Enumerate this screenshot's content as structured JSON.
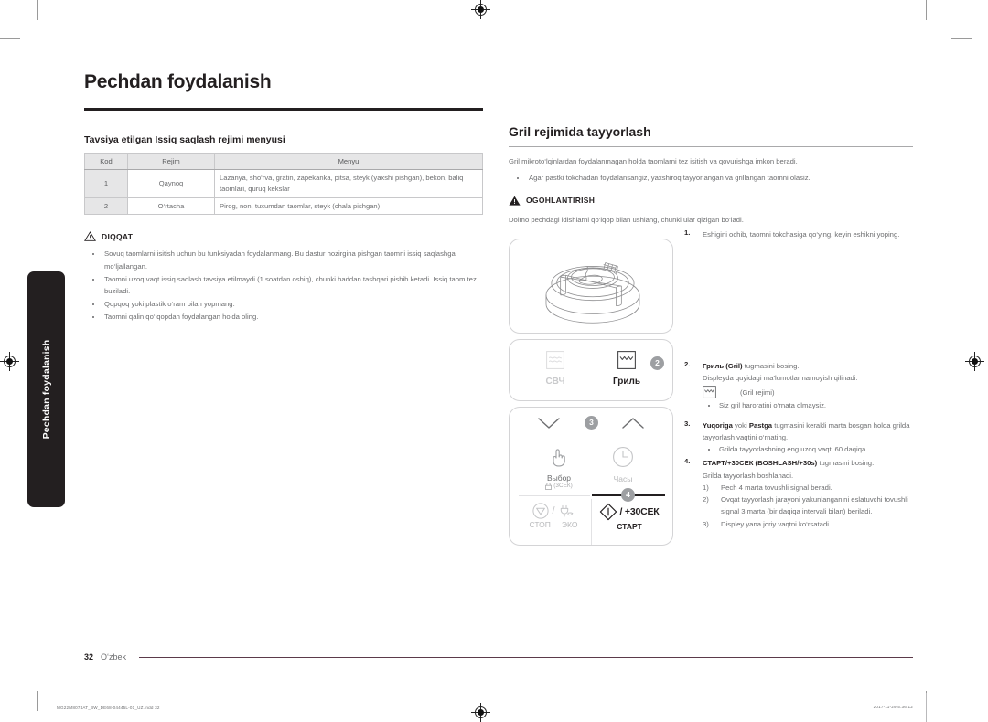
{
  "document": {
    "left_tab_label": "Pechdan foydalanish",
    "title": "Pechdan foydalanish"
  },
  "left_column": {
    "section_heading": "Tavsiya etilgan Issiq saqlash rejimi menyusi",
    "table": {
      "headers": [
        "Kod",
        "Rejim",
        "Menyu"
      ],
      "rows": [
        [
          "1",
          "Qaynoq",
          "Lazanya, sho‘rva, gratin, zapekanka, pitsa, steyk (yaxshi pishgan), bekon, baliq taomlari, quruq kekslar"
        ],
        [
          "2",
          "O‘rtacha",
          "Pirog, non, tuxumdan taomlar, steyk (chala pishgan)"
        ]
      ]
    },
    "caution": {
      "label": "DIQQAT",
      "items": [
        "Sovuq taomlarni isitish uchun bu funksiyadan foydalanmang. Bu dastur hozirgina pishgan taomni issiq saqlashga mo‘ljallangan.",
        "Taomni uzoq vaqt issiq saqlash tavsiya etilmaydi (1 soatdan oshiq), chunki haddan tashqari pishib ketadi. Issiq taom tez buziladi.",
        "Qopqoq yoki plastik o‘ram bilan yopmang.",
        "Taomni qalin qo‘lqopdan foydalangan holda oling."
      ]
    }
  },
  "right_column": {
    "heading": "Gril rejimida tayyorlash",
    "intro": "Gril mikroto‘lqinlardan foydalanmagan holda taomlarni tez isitish va qovurishga imkon beradi.",
    "intro_bullet": "Agar pastki tokchadan foydalansangiz, yaxshiroq tayyorlangan va grillangan taomni olasiz.",
    "warning": {
      "label": "OGOHLANTIRISH",
      "text": "Doimo pechdagi idishlarni qo‘lqop bilan ushlang, chunki ular qizigan bo‘ladi."
    },
    "panels": {
      "oven_illustration_name": "microwave-turntable-illustration",
      "modes": {
        "microwave_label": "СВЧ",
        "grill_label": "Гриль",
        "badge": "2"
      },
      "keys": {
        "down_arrow_name": "arrow-down",
        "up_arrow_name": "arrow-up",
        "badge_arrows": "3",
        "select_label": "Выбор",
        "select_sub": "(3СЕК)",
        "clock_label": "Часы",
        "stop_label": "СТОП",
        "eco_label": "ЭКО",
        "slash": "/",
        "start_plus_label": "/ +30СЕК",
        "start_label": "СТАРТ",
        "badge_start": "4"
      }
    },
    "steps": [
      {
        "num": "1.",
        "text": "Eshigini ochib, taomni tokchasiga qo‘ying, keyin eshikni yoping."
      },
      {
        "num": "2.",
        "bold_lead": "Гриль (Gril)",
        "text": " tugmasini bosing.",
        "line2": "Displeyda quyidagi ma’lumotlar namoyish qilinadi:",
        "icon_caption": "(Gril rejimi)",
        "bullet": "Siz gril haroratini o‘rnata olmaysiz."
      },
      {
        "num": "3.",
        "bold_a": "Yuqoriga",
        "mid": " yoki ",
        "bold_b": "Pastga",
        "text": " tugmasini kerakli marta bosgan holda grilda tayyorlash vaqtini o‘rnating.",
        "bullet": "Grilda tayyorlashning eng uzoq vaqti 60 daqiqa."
      },
      {
        "num": "4.",
        "bold_lead": "СТАРТ/+30СЕК (BOSHLASH/+30s)",
        "text": " tugmasini bosing.",
        "line2": "Grilda tayyorlash boshlanadi.",
        "ordered": [
          {
            "n": "1)",
            "t": "Pech 4 marta tovushli signal beradi."
          },
          {
            "n": "2)",
            "t": "Ovqat tayyorlash jarayoni yakunlanganini eslatuvchi tovushli signal 3 marta (bir daqiqa intervali bilan) beriladi."
          },
          {
            "n": "3)",
            "t": "Displey yana joriy vaqtni ko‘rsatadi."
          }
        ]
      }
    ]
  },
  "footer": {
    "page_number": "32",
    "language": "O‘zbek",
    "imprint": "MG22M8074AT_BW_DE68-04445L-01_UZ.indd   32",
    "timestamp": "2017-11-29   5:36:12"
  },
  "colors": {
    "ink": "#231f20",
    "body_text": "#6d6e70",
    "rule": "#5b3a4a",
    "panel_border": "#d4d4d6",
    "badge": "#9d9fa2",
    "table_header_bg": "#e6e6e7"
  }
}
